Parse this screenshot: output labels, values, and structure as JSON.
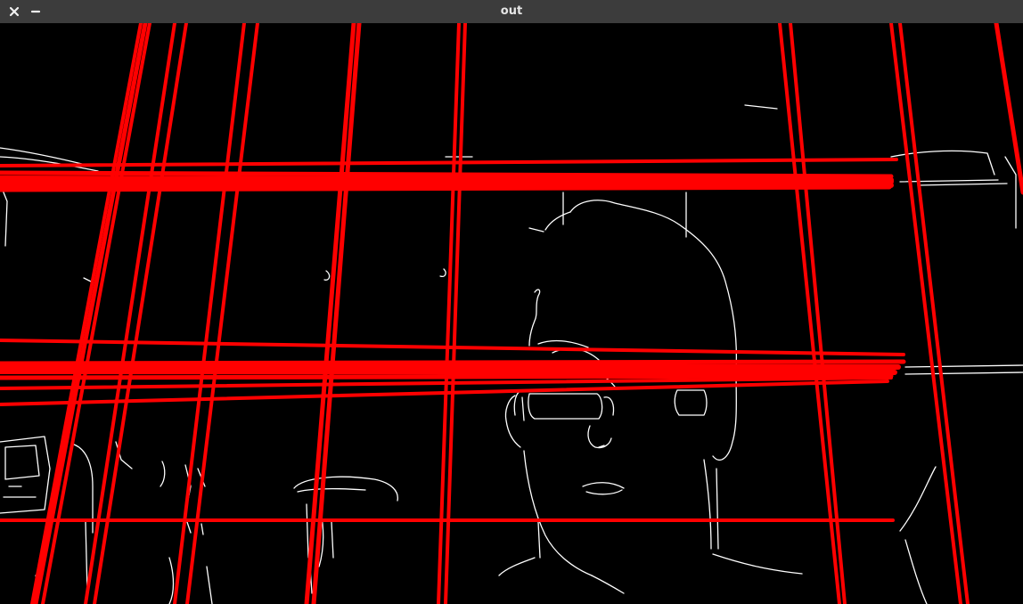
{
  "window": {
    "title": "out",
    "close_icon": "close-icon",
    "minimize_icon": "minimize-icon",
    "titlebar_color": "#3c3c3c",
    "title_color": "#e6e6e6"
  },
  "image": {
    "background_color": "#000000",
    "edge_color": "#ffffff",
    "line_color": "#ff0000"
  }
}
